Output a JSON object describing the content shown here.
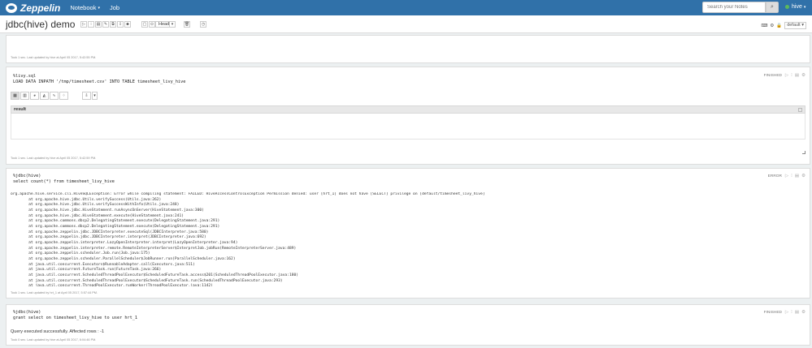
{
  "navbar": {
    "brand": "Zeppelin",
    "menu": [
      {
        "label": "Notebook",
        "caret": "▾"
      },
      {
        "label": "Job",
        "caret": ""
      }
    ],
    "search_placeholder": "Search your Notes",
    "user": "hive"
  },
  "note": {
    "title": "jdbc(hive) demo",
    "head_label": "Head",
    "interpreter_binding": "default"
  },
  "paragraphs": [
    {
      "meta": "Took 1 sec. Last updated by hive at April 05 2017, 5:42:55 PM."
    },
    {
      "code": "%livy.sql\nLOAD DATA INPATH '/tmp/timesheet.csv' INTO TABLE timesheet_livy_hive",
      "status": "FINISHED",
      "result_title": "result",
      "meta": "Took 1 sec. Last updated by hive at April 05 2017, 5:42:59 PM."
    },
    {
      "code": "%jdbc(hive)\nselect count(*) from timesheet_livy_hive",
      "status": "ERROR",
      "output": "org.apache.hive.service.cli.HiveSQLException: Error while compiling statement: FAILED: HiveAccessControlException Permission denied: user [hrt_1] does not have [SELECT] privilege on [default/timesheet_livy_hive]\n\tat org.apache.hive.jdbc.Utils.verifySuccess(Utils.java:262)\n\tat org.apache.hive.jdbc.Utils.verifySuccessWithInfo(Utils.java:248)\n\tat org.apache.hive.jdbc.HiveStatement.runAsyncOnServer(HiveStatement.java:300)\n\tat org.apache.hive.jdbc.HiveStatement.execute(HiveStatement.java:241)\n\tat org.apache.commons.dbcp2.DelegatingStatement.execute(DelegatingStatement.java:291)\n\tat org.apache.commons.dbcp2.DelegatingStatement.execute(DelegatingStatement.java:291)\n\tat org.apache.zeppelin.jdbc.JDBCInterpreter.executeSql(JDBCInterpreter.java:580)\n\tat org.apache.zeppelin.jdbc.JDBCInterpreter.interpret(JDBCInterpreter.java:692)\n\tat org.apache.zeppelin.interpreter.LazyOpenInterpreter.interpret(LazyOpenInterpreter.java:94)\n\tat org.apache.zeppelin.interpreter.remote.RemoteInterpreterServer$InterpretJob.jobRun(RemoteInterpreterServer.java:489)\n\tat org.apache.zeppelin.scheduler.Job.run(Job.java:175)\n\tat org.apache.zeppelin.scheduler.ParallelScheduler$JobRunner.run(ParallelScheduler.java:162)\n\tat java.util.concurrent.Executors$RunnableAdapter.call(Executors.java:511)\n\tat java.util.concurrent.FutureTask.run(FutureTask.java:266)\n\tat java.util.concurrent.ScheduledThreadPoolExecutor$ScheduledFutureTask.access$201(ScheduledThreadPoolExecutor.java:180)\n\tat java.util.concurrent.ScheduledThreadPoolExecutor$ScheduledFutureTask.run(ScheduledThreadPoolExecutor.java:293)\n\tat java.util.concurrent.ThreadPoolExecutor.runWorker(ThreadPoolExecutor.java:1142)",
      "meta": "Took 1 sec. Last updated by hrt_1 at April 05 2017, 5:57:44 PM."
    },
    {
      "code": "%jdbc(hive)\ngrant select on timesheet_livy_hive to user hrt_1",
      "status": "FINISHED",
      "output": "Query executed successfully. Affected rows : -1",
      "meta": "Took 0 sec. Last updated by hive at April 05 2017, 6:04:46 PM."
    }
  ]
}
